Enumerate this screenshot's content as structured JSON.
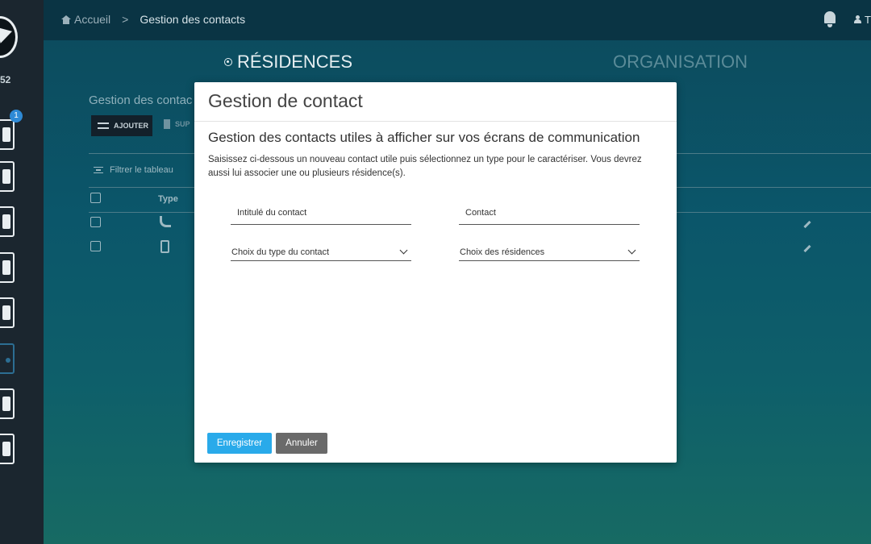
{
  "sidebar": {
    "count_label": "52",
    "badge": "1"
  },
  "breadcrumb": {
    "home": "Accueil",
    "separator": ">",
    "current": "Gestion des contacts"
  },
  "header": {
    "user_initial": "T"
  },
  "tabs": [
    {
      "label": "RÉSIDENCES",
      "active": true
    },
    {
      "label": "ORGANISATION",
      "active": false
    }
  ],
  "background": {
    "section_title": "Gestion des contac",
    "add_button": "AJOUTER",
    "delete_button": "SUP",
    "filter": "Filtrer le tableau",
    "col_type": "Type"
  },
  "modal": {
    "title": "Gestion de contact",
    "subtitle": "Gestion des contacts utiles à afficher sur vos écrans de communication",
    "description": "Saisissez ci-dessous un nouveau contact utile puis sélectionnez un type pour le caractériser. Vous devrez aussi lui associer une ou plusieurs résidence(s).",
    "fields": {
      "title_placeholder": "Intitulé du contact",
      "contact_placeholder": "Contact",
      "type_select": "Choix du type du contact",
      "residences_select": "Choix des résidences"
    },
    "buttons": {
      "save": "Enregistrer",
      "cancel": "Annuler"
    }
  },
  "colors": {
    "accent": "#29aaea",
    "cancel": "#6a6a6a",
    "sidebar": "#1b262f",
    "topbar": "#0a3444"
  }
}
